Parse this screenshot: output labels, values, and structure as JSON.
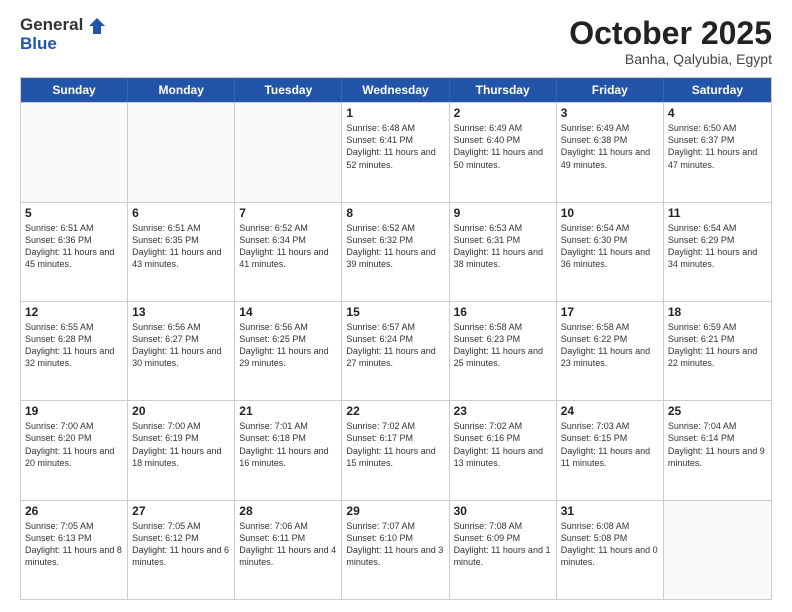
{
  "header": {
    "logo_line1": "General",
    "logo_line2": "Blue",
    "month": "October 2025",
    "location": "Banha, Qalyubia, Egypt"
  },
  "weekdays": [
    "Sunday",
    "Monday",
    "Tuesday",
    "Wednesday",
    "Thursday",
    "Friday",
    "Saturday"
  ],
  "rows": [
    [
      {
        "day": "",
        "sunrise": "",
        "sunset": "",
        "daylight": ""
      },
      {
        "day": "",
        "sunrise": "",
        "sunset": "",
        "daylight": ""
      },
      {
        "day": "",
        "sunrise": "",
        "sunset": "",
        "daylight": ""
      },
      {
        "day": "1",
        "sunrise": "Sunrise: 6:48 AM",
        "sunset": "Sunset: 6:41 PM",
        "daylight": "Daylight: 11 hours and 52 minutes."
      },
      {
        "day": "2",
        "sunrise": "Sunrise: 6:49 AM",
        "sunset": "Sunset: 6:40 PM",
        "daylight": "Daylight: 11 hours and 50 minutes."
      },
      {
        "day": "3",
        "sunrise": "Sunrise: 6:49 AM",
        "sunset": "Sunset: 6:38 PM",
        "daylight": "Daylight: 11 hours and 49 minutes."
      },
      {
        "day": "4",
        "sunrise": "Sunrise: 6:50 AM",
        "sunset": "Sunset: 6:37 PM",
        "daylight": "Daylight: 11 hours and 47 minutes."
      }
    ],
    [
      {
        "day": "5",
        "sunrise": "Sunrise: 6:51 AM",
        "sunset": "Sunset: 6:36 PM",
        "daylight": "Daylight: 11 hours and 45 minutes."
      },
      {
        "day": "6",
        "sunrise": "Sunrise: 6:51 AM",
        "sunset": "Sunset: 6:35 PM",
        "daylight": "Daylight: 11 hours and 43 minutes."
      },
      {
        "day": "7",
        "sunrise": "Sunrise: 6:52 AM",
        "sunset": "Sunset: 6:34 PM",
        "daylight": "Daylight: 11 hours and 41 minutes."
      },
      {
        "day": "8",
        "sunrise": "Sunrise: 6:52 AM",
        "sunset": "Sunset: 6:32 PM",
        "daylight": "Daylight: 11 hours and 39 minutes."
      },
      {
        "day": "9",
        "sunrise": "Sunrise: 6:53 AM",
        "sunset": "Sunset: 6:31 PM",
        "daylight": "Daylight: 11 hours and 38 minutes."
      },
      {
        "day": "10",
        "sunrise": "Sunrise: 6:54 AM",
        "sunset": "Sunset: 6:30 PM",
        "daylight": "Daylight: 11 hours and 36 minutes."
      },
      {
        "day": "11",
        "sunrise": "Sunrise: 6:54 AM",
        "sunset": "Sunset: 6:29 PM",
        "daylight": "Daylight: 11 hours and 34 minutes."
      }
    ],
    [
      {
        "day": "12",
        "sunrise": "Sunrise: 6:55 AM",
        "sunset": "Sunset: 6:28 PM",
        "daylight": "Daylight: 11 hours and 32 minutes."
      },
      {
        "day": "13",
        "sunrise": "Sunrise: 6:56 AM",
        "sunset": "Sunset: 6:27 PM",
        "daylight": "Daylight: 11 hours and 30 minutes."
      },
      {
        "day": "14",
        "sunrise": "Sunrise: 6:56 AM",
        "sunset": "Sunset: 6:25 PM",
        "daylight": "Daylight: 11 hours and 29 minutes."
      },
      {
        "day": "15",
        "sunrise": "Sunrise: 6:57 AM",
        "sunset": "Sunset: 6:24 PM",
        "daylight": "Daylight: 11 hours and 27 minutes."
      },
      {
        "day": "16",
        "sunrise": "Sunrise: 6:58 AM",
        "sunset": "Sunset: 6:23 PM",
        "daylight": "Daylight: 11 hours and 25 minutes."
      },
      {
        "day": "17",
        "sunrise": "Sunrise: 6:58 AM",
        "sunset": "Sunset: 6:22 PM",
        "daylight": "Daylight: 11 hours and 23 minutes."
      },
      {
        "day": "18",
        "sunrise": "Sunrise: 6:59 AM",
        "sunset": "Sunset: 6:21 PM",
        "daylight": "Daylight: 11 hours and 22 minutes."
      }
    ],
    [
      {
        "day": "19",
        "sunrise": "Sunrise: 7:00 AM",
        "sunset": "Sunset: 6:20 PM",
        "daylight": "Daylight: 11 hours and 20 minutes."
      },
      {
        "day": "20",
        "sunrise": "Sunrise: 7:00 AM",
        "sunset": "Sunset: 6:19 PM",
        "daylight": "Daylight: 11 hours and 18 minutes."
      },
      {
        "day": "21",
        "sunrise": "Sunrise: 7:01 AM",
        "sunset": "Sunset: 6:18 PM",
        "daylight": "Daylight: 11 hours and 16 minutes."
      },
      {
        "day": "22",
        "sunrise": "Sunrise: 7:02 AM",
        "sunset": "Sunset: 6:17 PM",
        "daylight": "Daylight: 11 hours and 15 minutes."
      },
      {
        "day": "23",
        "sunrise": "Sunrise: 7:02 AM",
        "sunset": "Sunset: 6:16 PM",
        "daylight": "Daylight: 11 hours and 13 minutes."
      },
      {
        "day": "24",
        "sunrise": "Sunrise: 7:03 AM",
        "sunset": "Sunset: 6:15 PM",
        "daylight": "Daylight: 11 hours and 11 minutes."
      },
      {
        "day": "25",
        "sunrise": "Sunrise: 7:04 AM",
        "sunset": "Sunset: 6:14 PM",
        "daylight": "Daylight: 11 hours and 9 minutes."
      }
    ],
    [
      {
        "day": "26",
        "sunrise": "Sunrise: 7:05 AM",
        "sunset": "Sunset: 6:13 PM",
        "daylight": "Daylight: 11 hours and 8 minutes."
      },
      {
        "day": "27",
        "sunrise": "Sunrise: 7:05 AM",
        "sunset": "Sunset: 6:12 PM",
        "daylight": "Daylight: 11 hours and 6 minutes."
      },
      {
        "day": "28",
        "sunrise": "Sunrise: 7:06 AM",
        "sunset": "Sunset: 6:11 PM",
        "daylight": "Daylight: 11 hours and 4 minutes."
      },
      {
        "day": "29",
        "sunrise": "Sunrise: 7:07 AM",
        "sunset": "Sunset: 6:10 PM",
        "daylight": "Daylight: 11 hours and 3 minutes."
      },
      {
        "day": "30",
        "sunrise": "Sunrise: 7:08 AM",
        "sunset": "Sunset: 6:09 PM",
        "daylight": "Daylight: 11 hours and 1 minute."
      },
      {
        "day": "31",
        "sunrise": "Sunrise: 6:08 AM",
        "sunset": "Sunset: 5:08 PM",
        "daylight": "Daylight: 11 hours and 0 minutes."
      },
      {
        "day": "",
        "sunrise": "",
        "sunset": "",
        "daylight": ""
      }
    ]
  ]
}
